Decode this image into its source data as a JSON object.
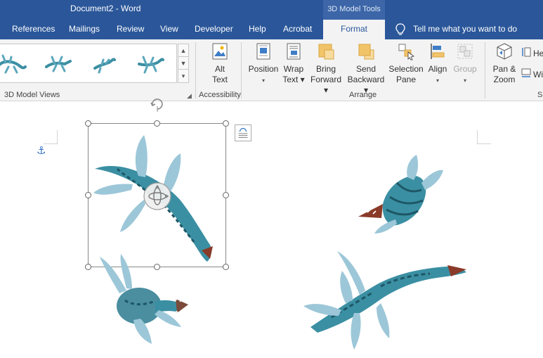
{
  "window": {
    "title": "Document2  -  Word",
    "context_tab_label": "3D Model Tools"
  },
  "tabs": [
    {
      "label": "References"
    },
    {
      "label": "Mailings"
    },
    {
      "label": "Review"
    },
    {
      "label": "View"
    },
    {
      "label": "Developer"
    },
    {
      "label": "Help"
    },
    {
      "label": "Acrobat"
    },
    {
      "label": "Format"
    }
  ],
  "tell_me": "Tell me what you want to do",
  "ribbon": {
    "groups": {
      "views": "3D Model Views",
      "accessibility": "Accessibility",
      "arrange": "Arrange"
    },
    "buttons": {
      "alt_text": [
        "Alt",
        "Text"
      ],
      "position": [
        "Position",
        "▾"
      ],
      "wrap_text": [
        "Wrap",
        "Text ▾"
      ],
      "bring_forward": [
        "Bring",
        "Forward ▾"
      ],
      "send_backward": [
        "Send",
        "Backward ▾"
      ],
      "selection_pane": [
        "Selection",
        "Pane"
      ],
      "align": [
        "Align",
        "▾"
      ],
      "group": [
        "Group",
        "▾"
      ],
      "pan_zoom": [
        "Pan &",
        "Zoom"
      ],
      "height_partial": "He",
      "width_partial": "Wi",
      "size_partial": "S"
    }
  },
  "colors": {
    "title_bar": "#2b579a",
    "ribbon_bg": "#f3f3f3",
    "model_teal": "#3b8fa3",
    "model_light": "#9cc7d8"
  },
  "icons": [
    "lightbulb-icon",
    "alt-text-icon",
    "position-icon",
    "wrap-text-icon",
    "bring-forward-icon",
    "send-backward-icon",
    "selection-pane-icon",
    "align-icon",
    "group-icon",
    "pan-zoom-icon",
    "height-icon",
    "width-icon",
    "anchor-icon",
    "rotate-icon",
    "layout-options-icon",
    "pan-3d-icon"
  ]
}
